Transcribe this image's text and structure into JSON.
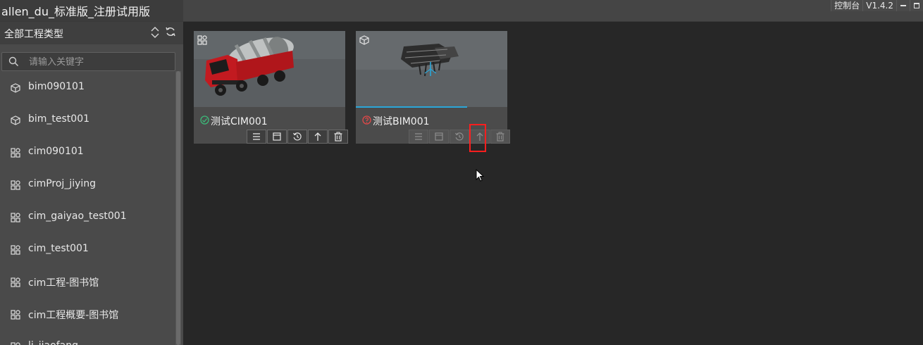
{
  "window": {
    "title": "allen_du_标准版_注册试用版",
    "console_label": "控制台",
    "version": "V1.4.2"
  },
  "sidebar": {
    "category_label": "全部工程类型",
    "search_placeholder": "请输入关键字",
    "items": [
      {
        "label": "bim090101",
        "icon": "cube-icon"
      },
      {
        "label": "bim_test001",
        "icon": "cube-icon"
      },
      {
        "label": "cim090101",
        "icon": "grid-icon"
      },
      {
        "label": "cimProj_jiying",
        "icon": "grid-icon"
      },
      {
        "label": "cim_gaiyao_test001",
        "icon": "grid-icon"
      },
      {
        "label": "cim_test001",
        "icon": "grid-icon"
      },
      {
        "label": "cim工程-图书馆",
        "icon": "grid-icon"
      },
      {
        "label": "cim工程概要-图书馆",
        "icon": "grid-icon"
      },
      {
        "label": "li_jiaofang",
        "icon": "grid-icon"
      }
    ]
  },
  "projects": [
    {
      "name": "测试CIM001",
      "type_icon": "grid-icon",
      "status": "success",
      "actions": [
        "list-icon",
        "window-icon",
        "history-icon",
        "upload-icon",
        "delete-icon"
      ]
    },
    {
      "name": "测试BIM001",
      "type_icon": "cube-icon",
      "status": "warning",
      "actions": [
        "list-icon",
        "window-icon",
        "history-icon",
        "upload-icon",
        "delete-icon"
      ]
    }
  ],
  "colors": {
    "success": "#3cb878",
    "warning": "#e04848",
    "progress": "#2aa6d8",
    "highlight": "#ff1e1e"
  }
}
